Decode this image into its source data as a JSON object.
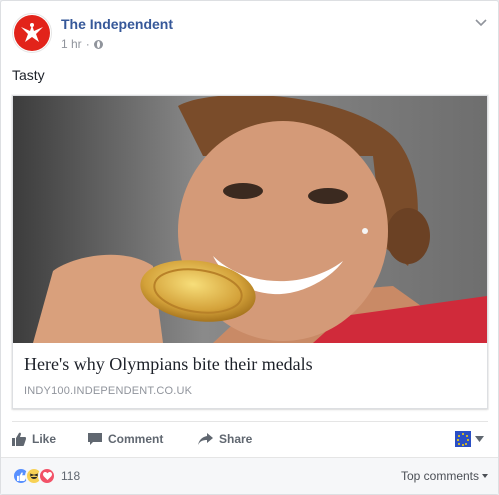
{
  "post": {
    "page_name": "The Independent",
    "timestamp": "1 hr",
    "separator": "·",
    "text": "Tasty",
    "logo_color": "#e2231a"
  },
  "link": {
    "headline": "Here's why Olympians bite their medals",
    "domain": "INDY100.INDEPENDENT.CO.UK",
    "image_alt": "Athlete biting a gold medal"
  },
  "actions": {
    "like": "Like",
    "comment": "Comment",
    "share": "Share",
    "audience_icon": "eu-flag-icon"
  },
  "reactions": {
    "types": [
      "like",
      "haha",
      "love"
    ],
    "count": "118",
    "sort_label": "Top comments"
  },
  "colors": {
    "link_blue": "#365899",
    "meta_gray": "#90949c",
    "action_gray": "#606770"
  }
}
